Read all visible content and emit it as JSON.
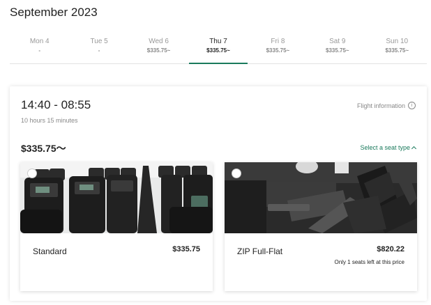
{
  "calendar": {
    "month": "September 2023",
    "dates": [
      {
        "day": "Mon 4",
        "price": "-"
      },
      {
        "day": "Tue 5",
        "price": "-"
      },
      {
        "day": "Wed 6",
        "price": "$335.75~"
      },
      {
        "day": "Thu 7",
        "price": "$335.75~"
      },
      {
        "day": "Fri 8",
        "price": "$335.75~"
      },
      {
        "day": "Sat 9",
        "price": "$335.75~"
      },
      {
        "day": "Sun 10",
        "price": "$335.75~"
      }
    ],
    "selected_index": 3
  },
  "flight": {
    "time_range": "14:40 - 08:55",
    "duration": "10 hours 15 minutes",
    "info_label": "Flight information",
    "from_price": "$335.75～",
    "seat_type_label": "Select a seat type"
  },
  "seats": [
    {
      "name": "Standard",
      "price": "$335.75",
      "note": ""
    },
    {
      "name": "ZIP Full-Flat",
      "price": "$820.22",
      "note": "Only 1 seats left at this price"
    }
  ],
  "colors": {
    "accent": "#1a7a5c"
  }
}
